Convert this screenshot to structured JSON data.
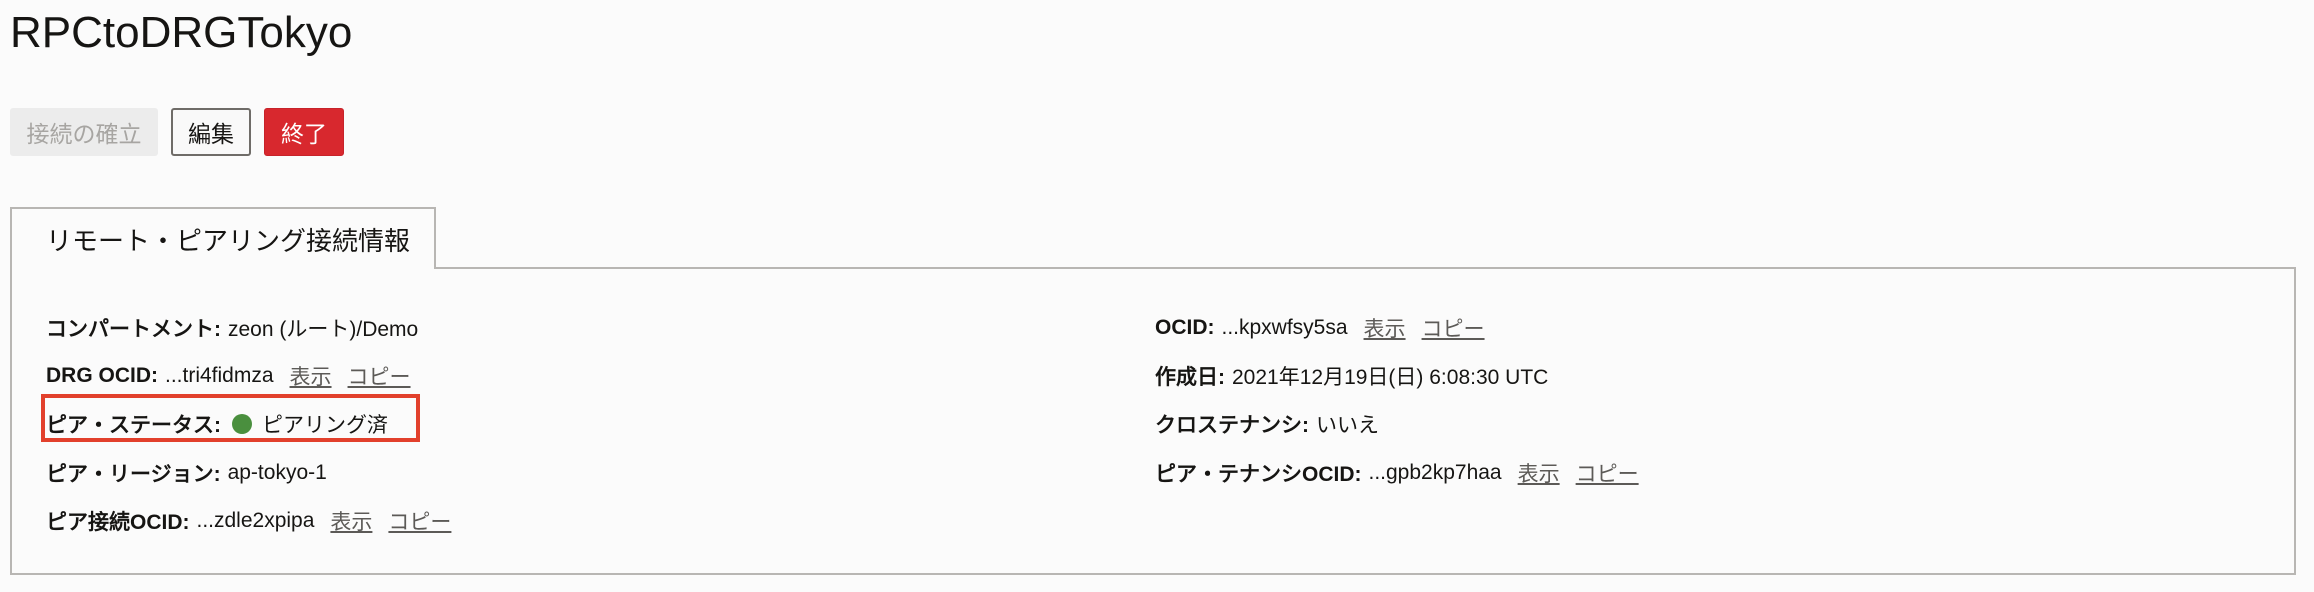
{
  "header": {
    "title": "RPCtoDRGTokyo"
  },
  "actions": {
    "establish_label": "接続の確立",
    "edit_label": "編集",
    "terminate_label": "終了"
  },
  "tab": {
    "label": "リモート・ピアリング接続情報"
  },
  "details": {
    "left": {
      "compartment": {
        "label": "コンパートメント:",
        "value": "zeon (ルート)/Demo"
      },
      "drg_ocid": {
        "label": "DRG OCID:",
        "value": "...tri4fidmza",
        "show": "表示",
        "copy": "コピー"
      },
      "peer_status": {
        "label": "ピア・ステータス:",
        "value": "ピアリング済",
        "status_color": "#4a8f3e"
      },
      "peer_region": {
        "label": "ピア・リージョン:",
        "value": "ap-tokyo-1"
      },
      "peer_connection_ocid": {
        "label": "ピア接続OCID:",
        "value": "...zdle2xpipa",
        "show": "表示",
        "copy": "コピー"
      }
    },
    "right": {
      "ocid": {
        "label": "OCID:",
        "value": "...kpxwfsy5sa",
        "show": "表示",
        "copy": "コピー"
      },
      "created": {
        "label": "作成日:",
        "value": "2021年12月19日(日) 6:08:30 UTC"
      },
      "cross_tenancy": {
        "label": "クロステナンシ:",
        "value": "いいえ"
      },
      "peer_tenancy_ocid": {
        "label": "ピア・テナンシOCID:",
        "value": "...gpb2kp7haa",
        "show": "表示",
        "copy": "コピー"
      }
    }
  },
  "colors": {
    "danger": "#d8282e",
    "highlight": "#e2402c",
    "status_green": "#4a8f3e"
  }
}
